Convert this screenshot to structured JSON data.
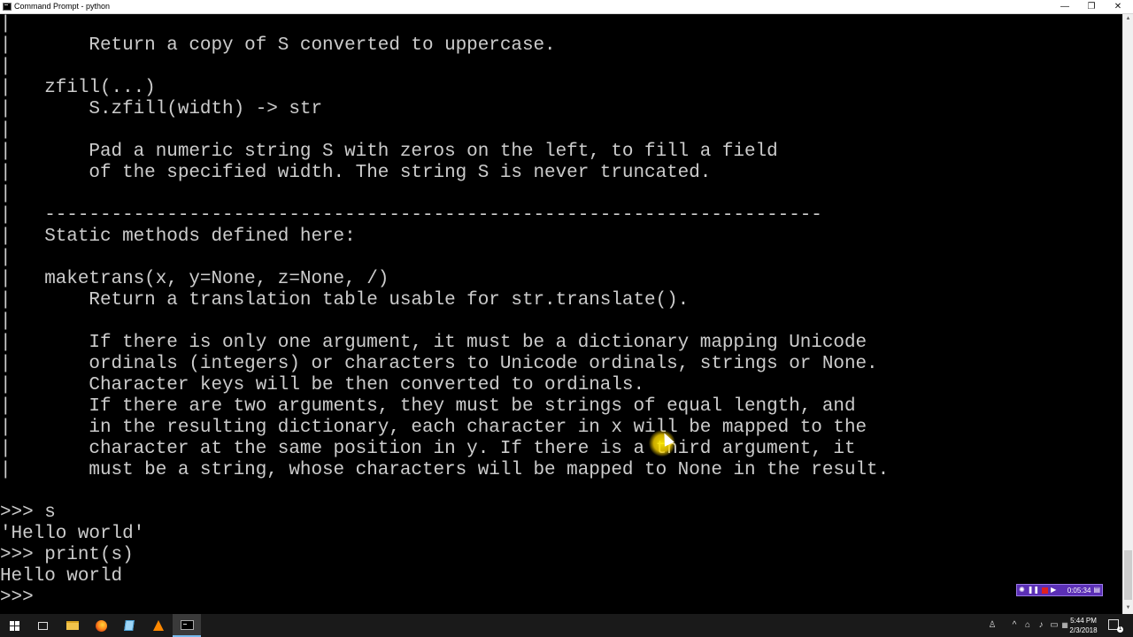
{
  "window": {
    "title": "Command Prompt - python",
    "minimize": "—",
    "maximize": "❐",
    "close": "✕"
  },
  "console": {
    "lines": [
      "|",
      "|       Return a copy of S converted to uppercase.",
      "|",
      "|   zfill(...)",
      "|       S.zfill(width) -> str",
      "|",
      "|       Pad a numeric string S with zeros on the left, to fill a field",
      "|       of the specified width. The string S is never truncated.",
      "|",
      "|   ----------------------------------------------------------------------",
      "|   Static methods defined here:",
      "|",
      "|   maketrans(x, y=None, z=None, /)",
      "|       Return a translation table usable for str.translate().",
      "|",
      "|       If there is only one argument, it must be a dictionary mapping Unicode",
      "|       ordinals (integers) or characters to Unicode ordinals, strings or None.",
      "|       Character keys will be then converted to ordinals.",
      "|       If there are two arguments, they must be strings of equal length, and",
      "|       in the resulting dictionary, each character in x will be mapped to the",
      "|       character at the same position in y. If there is a third argument, it",
      "|       must be a string, whose characters will be mapped to None in the result.",
      "",
      ">>> s",
      "'Hello world'",
      ">>> print(s)",
      "Hello world",
      ">>>"
    ]
  },
  "scrollbar": {
    "up_arrow": "▲",
    "down_arrow": "▼"
  },
  "recorder": {
    "time": "0:05:34",
    "pause": "❚❚",
    "play": "▶",
    "menu": "▤"
  },
  "taskbar": {
    "items": [
      "start",
      "task-view",
      "file-explorer",
      "firefox",
      "notepad",
      "vlc",
      "command-prompt"
    ],
    "tray": {
      "people": "♙",
      "chevron": "^",
      "network": "⌂",
      "volume": "♪",
      "display": "▭",
      "keyboard": "▦",
      "time": "5:44 PM",
      "date": "2/3/2018",
      "notification_count": "1"
    }
  }
}
